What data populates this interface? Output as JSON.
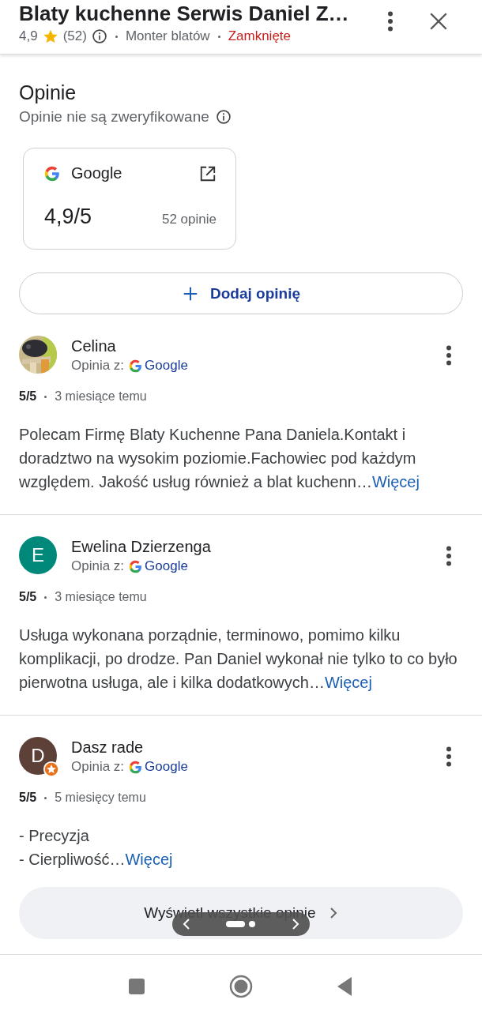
{
  "header": {
    "title": "Blaty kuchenne Serwis Daniel Z…",
    "rating": "4,9",
    "count": "(52)",
    "category": "Monter blatów",
    "status": "Zamknięte"
  },
  "section": {
    "title": "Opinie",
    "subtitle": "Opinie nie są zweryfikowane"
  },
  "source_card": {
    "name": "Google",
    "score": "4,9/5",
    "count": "52 opinie"
  },
  "add_button": {
    "label": "Dodaj opinię"
  },
  "reviews": [
    {
      "author": "Celina",
      "local_guide": false,
      "source_label": "Opinia z:",
      "source": "Google",
      "rating": "5/5",
      "time": "3 miesiące temu",
      "text": "Polecam Firmę Blaty Kuchenne Pana Daniela.Kontakt i doradztwo na wysokim poziomie.Fachowiec pod każdym względem. Jakość usług również a blat kuchenn…",
      "more": "Więcej"
    },
    {
      "author": "Ewelina Dzierzenga",
      "avatar": {
        "kind": "letter",
        "initial": "E",
        "color": "#00897b"
      },
      "local_guide": false,
      "source_label": "Opinia z:",
      "source": "Google",
      "rating": "5/5",
      "time": "3 miesiące temu",
      "text": "Usługa wykonana porządnie, terminowo, pomimo kilku komplikacji, po drodze. Pan Daniel wykonał nie tylko to co było pierwotna usługa, ale i kilka dodatkowych…",
      "more": "Więcej"
    },
    {
      "author": "Dasz rade",
      "avatar": {
        "kind": "letter",
        "initial": "D",
        "color": "#5d4037"
      },
      "local_guide": true,
      "source_label": "Opinia z:",
      "source": "Google",
      "rating": "5/5",
      "time": "5 miesięcy temu",
      "text": "- Precyzja\n- Cierpliwość…",
      "more": "Więcej"
    }
  ],
  "all_button": {
    "label": "Wyświetl wszystkie opinie"
  }
}
